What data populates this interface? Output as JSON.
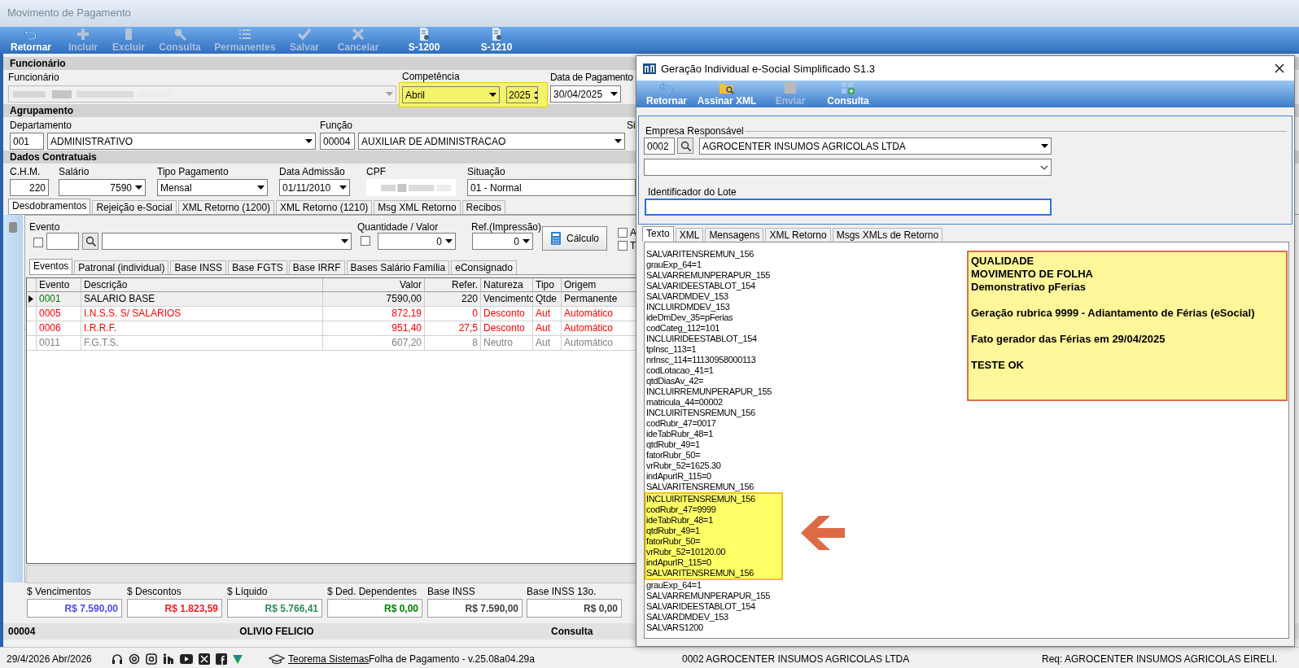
{
  "main_window": {
    "title": "Movimento de Pagamento",
    "toolbar": [
      {
        "label": "Retornar",
        "kind": "undo",
        "disabled": false
      },
      {
        "label": "Incluir",
        "kind": "plus",
        "disabled": true
      },
      {
        "label": "Excluir",
        "kind": "clipboard",
        "disabled": true
      },
      {
        "label": "Consulta",
        "kind": "search",
        "disabled": true
      },
      {
        "label": "Permanentes",
        "kind": "list",
        "disabled": true
      },
      {
        "label": "Salvar",
        "kind": "check",
        "disabled": true
      },
      {
        "label": "Cancelar",
        "kind": "cancel",
        "disabled": true
      },
      {
        "label": "S-1200",
        "kind": "document",
        "disabled": false
      },
      {
        "label": "S-1210",
        "kind": "document",
        "disabled": false
      }
    ],
    "funcionario": {
      "header": "Funcionário",
      "employee_label": "Funcionário",
      "competencia_label": "Competência",
      "month": "Abril",
      "year": "2025",
      "competencia_highlighted": true,
      "payment_date_label": "Data de Pagamento",
      "payment_date": "30/04/2025"
    },
    "agrupamento": {
      "header": "Agrupamento",
      "department_label": "Departamento",
      "department_code": "001",
      "department": "ADMINISTRATIVO",
      "function_label": "Função",
      "function_code": "00004",
      "function": "AUXILIAR DE ADMINISTRACAO",
      "cut_label": "Si"
    },
    "dados_contratuais": {
      "header": "Dados Contratuais",
      "chm_label": "C.H.M.",
      "chm": "220",
      "salary_label": "Salário",
      "salary": "7590",
      "payment_type_label": "Tipo Pagamento",
      "payment_type": "Mensal",
      "admission_label": "Data Admissão",
      "admission": "01/11/2010",
      "cpf_label": "CPF",
      "situation_label": "Situação",
      "situation": "01 - Normal"
    },
    "tabs": [
      {
        "label": "Desdobramentos",
        "selected": true
      },
      {
        "label": "Rejeição e-Social",
        "selected": false
      },
      {
        "label": "XML Retorno (1200)",
        "selected": false
      },
      {
        "label": "XML Retorno (1210)",
        "selected": false
      },
      {
        "label": "Msg XML Retorno",
        "selected": false
      },
      {
        "label": "Recibos",
        "selected": false
      }
    ],
    "evento_panel": {
      "evento_label": "Evento",
      "evento_checked": false,
      "quantity_label": "Quantidade / Valor",
      "quantity_checked": false,
      "quantity": "0",
      "ref_label": "Ref.(Impressão)",
      "ref": "0",
      "calc_button": "Cálculo",
      "checkboxes": [
        {
          "label": "A",
          "checked": false
        },
        {
          "label": "T",
          "checked": false
        }
      ]
    },
    "subtabs": [
      {
        "label": "Eventos",
        "selected": true
      },
      {
        "label": "Patronal (individual)",
        "selected": false
      },
      {
        "label": "Base INSS",
        "selected": false
      },
      {
        "label": "Base FGTS",
        "selected": false
      },
      {
        "label": "Base IRRF",
        "selected": false
      },
      {
        "label": "Bases Salário Família",
        "selected": false
      },
      {
        "label": "eConsignado",
        "selected": false
      }
    ],
    "table": {
      "columns": [
        "Evento",
        "Descrição",
        "Valor",
        "Refer.",
        "Natureza",
        "Tipo",
        "Origem"
      ],
      "rows": [
        {
          "cells": [
            {
              "text": "0001",
              "color": "#008000"
            },
            "SALARIO BASE",
            "7590,00",
            "220",
            "Vencimento",
            "Qtde",
            "Permanente"
          ],
          "selected": true,
          "color": "#000000"
        },
        {
          "cells": [
            {
              "text": "0005",
              "color": "#ff0000"
            },
            "I.N.S.S. S/ SALARIOS",
            "872,19",
            "0",
            "Desconto",
            "Aut",
            "Automático"
          ],
          "selected": false,
          "color": "#ff0000"
        },
        {
          "cells": [
            {
              "text": "0006",
              "color": "#ff0000"
            },
            "I.R.R.F.",
            "951,40",
            "27,5",
            "Desconto",
            "Aut",
            "Automático"
          ],
          "selected": false,
          "color": "#ff0000"
        },
        {
          "cells": [
            {
              "text": "0011",
              "color": "#808080"
            },
            "F.G.T.S.",
            "607,20",
            "8",
            "Neutro",
            "Aut",
            "Automático"
          ],
          "selected": false,
          "color": "#808080"
        }
      ]
    },
    "totals": [
      {
        "label": "$ Vencimentos",
        "value": "R$ 7.590,00",
        "color": "#4b4bf0"
      },
      {
        "label": "$ Descontos",
        "value": "R$ 1.823,59",
        "color": "#f01e1e"
      },
      {
        "label": "$ Líquido",
        "value": "R$ 5.766,41",
        "color": "#2e8b57"
      },
      {
        "label": "$ Ded. Dependentes",
        "value": "R$ 0,00",
        "color": "#008000"
      },
      {
        "label": "Base INSS",
        "value": "R$ 7.590,00",
        "color": "#404040"
      },
      {
        "label": "Base INSS 13o.",
        "value": "R$ 0,00",
        "color": "#404040"
      }
    ],
    "footer": {
      "code": "00004",
      "name": "OLIVIO FELICIO",
      "mode": "Consulta"
    }
  },
  "status_bar": {
    "date": "29/4/2026 Abr/2026",
    "link": "Teorema Sistemas",
    "version": "Folha de Pagamento - v.25.08a04.29a",
    "company": "0002 AGROCENTER INSUMOS AGRICOLAS LTDA",
    "req": "Req: AGROCENTER INSUMOS AGRICOLAS EIRELI."
  },
  "dialog": {
    "title": "Geração Individual e-Social Simplificado S1.3",
    "toolbar": [
      {
        "label": "Retornar",
        "kind": "undo",
        "disabled": false
      },
      {
        "label": "Assinar XML",
        "kind": "folder",
        "disabled": false
      },
      {
        "label": "Enviar",
        "kind": "stop",
        "disabled": true
      },
      {
        "label": "Consulta",
        "kind": "grid",
        "disabled": false
      }
    ],
    "company_legend": "Empresa Responsável",
    "company_code": "0002",
    "company": "AGROCENTER INSUMOS AGRICOLAS LTDA",
    "batch_label": "Identificador do Lote",
    "tabs": [
      {
        "label": "Texto",
        "selected": true
      },
      {
        "label": "XML",
        "selected": false
      },
      {
        "label": "Mensagens",
        "selected": false
      },
      {
        "label": "XML Retorno",
        "selected": false
      },
      {
        "label": "Msgs XMLs de Retorno",
        "selected": false
      }
    ],
    "lines": [
      {
        "text": "SALVARITENSREMUN_156",
        "highlighted": false
      },
      {
        "text": "grauExp_64=1",
        "highlighted": false
      },
      {
        "text": "SALVARREMUNPERAPUR_155",
        "highlighted": false
      },
      {
        "text": "SALVARIDEESTABLOT_154",
        "highlighted": false
      },
      {
        "text": "SALVARDMDEV_153",
        "highlighted": false
      },
      {
        "text": "INCLUIRDMDEV_153",
        "highlighted": false
      },
      {
        "text": "ideDmDev_35=pFerias",
        "highlighted": false
      },
      {
        "text": "codCateg_112=101",
        "highlighted": false
      },
      {
        "text": "INCLUIRIDEESTABLOT_154",
        "highlighted": false
      },
      {
        "text": "tpInsc_113=1",
        "highlighted": false
      },
      {
        "text": "nrInsc_114=11130958000113",
        "highlighted": false
      },
      {
        "text": "codLotacao_41=1",
        "highlighted": false
      },
      {
        "text": "qtdDiasAv_42=",
        "highlighted": false
      },
      {
        "text": "INCLUIRREMUNPERAPUR_155",
        "highlighted": false
      },
      {
        "text": "matricula_44=00002",
        "highlighted": false
      },
      {
        "text": "INCLUIRITENSREMUN_156",
        "highlighted": false
      },
      {
        "text": "codRubr_47=0017",
        "highlighted": false
      },
      {
        "text": "ideTabRubr_48=1",
        "highlighted": false
      },
      {
        "text": "qtdRubr_49=1",
        "highlighted": false
      },
      {
        "text": "fatorRubr_50=",
        "highlighted": false
      },
      {
        "text": "vrRubr_52=1625.30",
        "highlighted": false
      },
      {
        "text": "indApurIR_115=0",
        "highlighted": false
      },
      {
        "text": "SALVARITENSREMUN_156",
        "highlighted": false
      },
      {
        "text": "INCLUIRITENSREMUN_156",
        "highlighted": true
      },
      {
        "text": "codRubr_47=9999",
        "highlighted": true
      },
      {
        "text": "ideTabRubr_48=1",
        "highlighted": true
      },
      {
        "text": "qtdRubr_49=1",
        "highlighted": true
      },
      {
        "text": "fatorRubr_50=",
        "highlighted": true
      },
      {
        "text": "vrRubr_52=10120.00",
        "highlighted": true
      },
      {
        "text": "indApurIR_115=0",
        "highlighted": true
      },
      {
        "text": "SALVARITENSREMUN_156",
        "highlighted": true
      },
      {
        "text": "grauExp_64=1",
        "highlighted": false
      },
      {
        "text": "SALVARREMUNPERAPUR_155",
        "highlighted": false
      },
      {
        "text": "SALVARIDEESTABLOT_154",
        "highlighted": false
      },
      {
        "text": "SALVARDMDEV_153",
        "highlighted": false
      },
      {
        "text": "SALVARS1200",
        "highlighted": false
      }
    ],
    "note": {
      "paragraphs": [
        [
          "QUALIDADE",
          "MOVIMENTO DE FOLHA",
          "Demonstrativo pFerias"
        ],
        [
          "Geração rubrica 9999 - Adiantamento de Férias (eSocial)"
        ],
        [
          "Fato gerador das Férias em 29/04/2025"
        ],
        [
          "TESTE OK"
        ]
      ]
    }
  }
}
